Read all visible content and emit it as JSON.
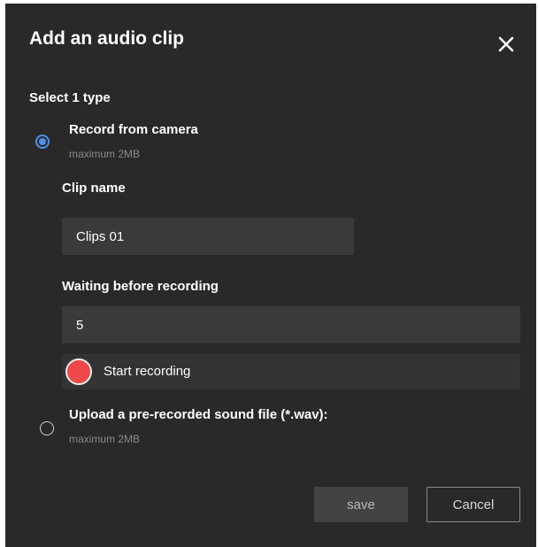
{
  "dialog": {
    "title": "Add an audio clip",
    "close_icon": "close-icon"
  },
  "type_section": {
    "label": "Select 1 type",
    "options": [
      {
        "title": "Record from camera",
        "subtitle": "maximum 2MB",
        "selected": true
      },
      {
        "title": "Upload a pre-recorded sound file (*.wav):",
        "subtitle": "maximum 2MB",
        "selected": false
      }
    ]
  },
  "clip_name": {
    "label": "Clip name",
    "value": "Clips 01"
  },
  "waiting": {
    "label": "Waiting before recording",
    "value": "5"
  },
  "record": {
    "label": "Start recording",
    "icon": "record-dot-icon"
  },
  "actions": {
    "save_label": "save",
    "cancel_label": "Cancel"
  },
  "colors": {
    "background": "#292929",
    "accent": "#4f8ff0",
    "record": "#ef4949"
  }
}
